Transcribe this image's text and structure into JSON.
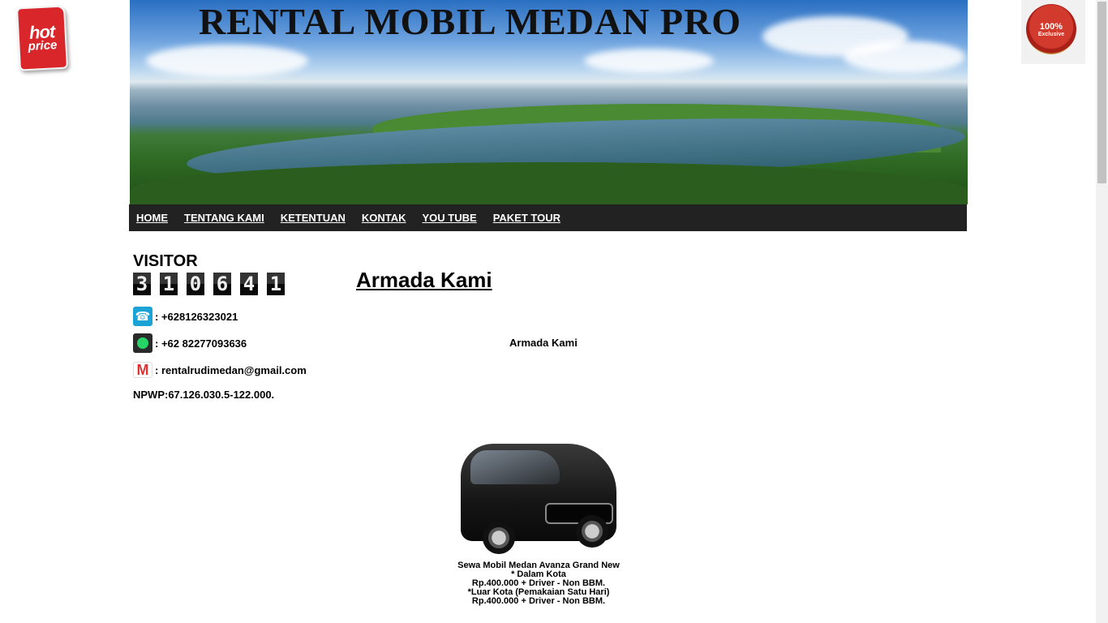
{
  "badges": {
    "hot_line1": "hot",
    "hot_line2": "price",
    "seal_line1": "100%",
    "seal_line2": "Exclusive"
  },
  "header": {
    "title": "RENTAL MOBIL MEDAN PRO"
  },
  "nav": {
    "items": [
      {
        "label": "HOME"
      },
      {
        "label": "TENTANG KAMI"
      },
      {
        "label": "KETENTUAN"
      },
      {
        "label": "KONTAK"
      },
      {
        "label": "YOU TUBE"
      },
      {
        "label": "PAKET TOUR"
      }
    ]
  },
  "sidebar": {
    "visitor_title": "VISITOR",
    "counter_digits": [
      "3",
      "1",
      "0",
      "6",
      "4",
      "1"
    ],
    "phone": ": +628126323021",
    "whatsapp": ": +62 82277093636",
    "email": ": rentalrudimedan@gmail.com",
    "npwp": "NPWP:67.126.030.5-122.000."
  },
  "icons": {
    "phone": "phone-icon",
    "whatsapp": "whatsapp-icon",
    "email": "gmail-icon"
  },
  "main": {
    "title": "Armada Kami",
    "subtitle": "Armada Kami",
    "car_caption": {
      "line1": "Sewa Mobil Medan Avanza Grand New",
      "line2": "* Dalam Kota",
      "line3": "Rp.400.000 + Driver - Non BBM.",
      "line4": "*Luar Kota (Pemakaian Satu Hari)",
      "line5": "Rp.400.000 + Driver - Non BBM."
    }
  },
  "colors": {
    "nav_bg": "#222222",
    "nav_text": "#ffffff",
    "hot_badge": "#d8262b",
    "phone_icon": "#1ba3d6"
  }
}
